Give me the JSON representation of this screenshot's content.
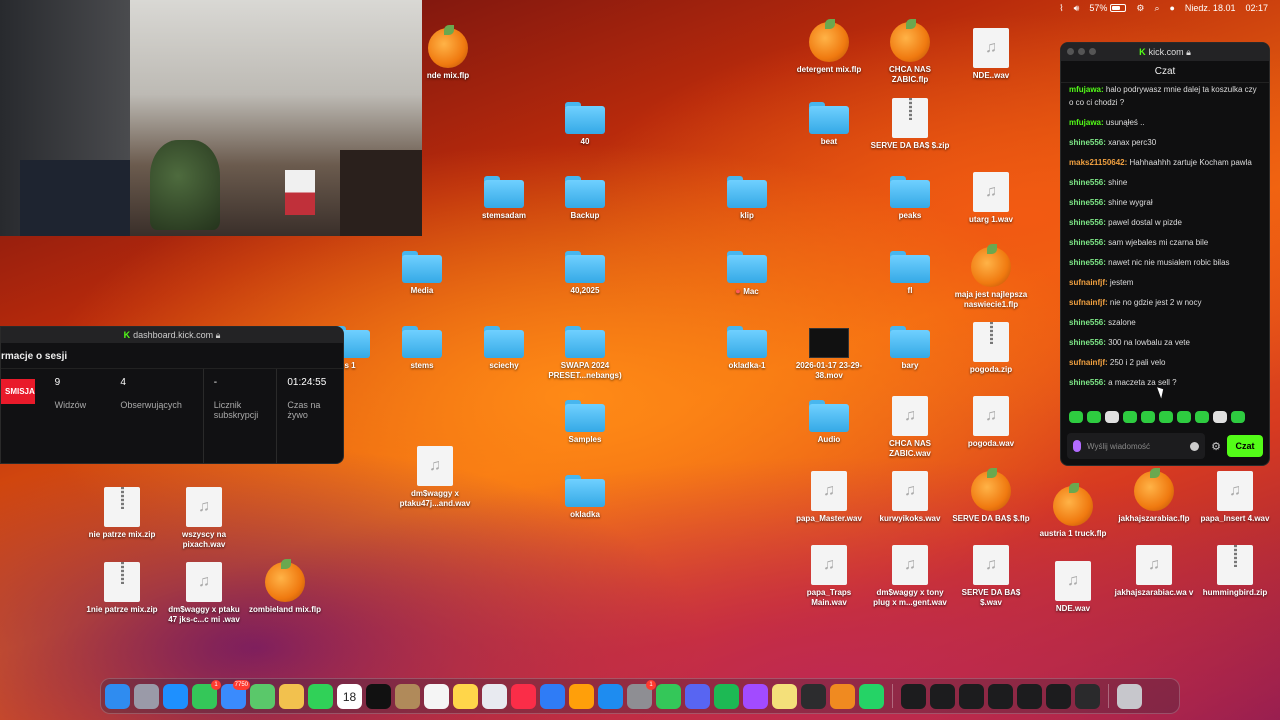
{
  "menubar": {
    "battery": "57%",
    "battery_level": 0.57,
    "date": "Niedz. 18.01",
    "time": "02:17"
  },
  "desktop_icons": [
    {
      "label": "nde mix.flp",
      "type": "flp"
    },
    {
      "label": "40",
      "type": "folder"
    },
    {
      "label": "stemsadam",
      "type": "folder"
    },
    {
      "label": "Backup",
      "type": "folder"
    },
    {
      "label": "Media",
      "type": "folder"
    },
    {
      "label": "40,2025",
      "type": "folder"
    },
    {
      "label": "s 1",
      "type": "folder"
    },
    {
      "label": "stems",
      "type": "folder"
    },
    {
      "label": "sciechy",
      "type": "folder"
    },
    {
      "label": "SWAPA 2024 PRESET...nebangs)",
      "type": "folder"
    },
    {
      "label": "Samples",
      "type": "folder"
    },
    {
      "label": "okladka",
      "type": "folder"
    },
    {
      "label": "dm$waggy x ptaku47j...and.wav",
      "type": "audio"
    },
    {
      "label": "nie patrze mix.zip",
      "type": "zip"
    },
    {
      "label": "wszyscy na pixach.wav",
      "type": "audio"
    },
    {
      "label": "1nie patrze mix.zip",
      "type": "zip"
    },
    {
      "label": "dm$waggy x ptaku 47 jks-c...c mi .wav",
      "type": "audio"
    },
    {
      "label": "zombieland mix.flp",
      "type": "flp"
    },
    {
      "label": "klip",
      "type": "folder"
    },
    {
      "label": "Mac",
      "type": "folder"
    },
    {
      "label": "okladka-1",
      "type": "folder"
    },
    {
      "label": "detergent mix.flp",
      "type": "flp"
    },
    {
      "label": "beat",
      "type": "folder"
    },
    {
      "label": "2026-01-17 23-29-38.mov",
      "type": "video"
    },
    {
      "label": "Audio",
      "type": "folder"
    },
    {
      "label": "papa_Master.wav",
      "type": "audio"
    },
    {
      "label": "papa_Traps Main.wav",
      "type": "audio"
    },
    {
      "label": "CHCA NAS ZABIC.flp",
      "type": "flp"
    },
    {
      "label": "SERVE DA BA$ $.zip",
      "type": "zip"
    },
    {
      "label": "peaks",
      "type": "folder"
    },
    {
      "label": "fl",
      "type": "folder"
    },
    {
      "label": "bary",
      "type": "folder"
    },
    {
      "label": "CHCA NAS ZABIC.wav",
      "type": "audio"
    },
    {
      "label": "kurwyikoks.wav",
      "type": "audio"
    },
    {
      "label": "dm$waggy x tony plug x m...gent.wav",
      "type": "audio"
    },
    {
      "label": "NDE..wav",
      "type": "audio"
    },
    {
      "label": "utarg 1.wav",
      "type": "audio"
    },
    {
      "label": "maja jest najlepsza naswiecie1.flp",
      "type": "flp"
    },
    {
      "label": "pogoda.zip",
      "type": "zip"
    },
    {
      "label": "pogoda.wav",
      "type": "audio"
    },
    {
      "label": "SERVE DA BA$ $.flp",
      "type": "flp"
    },
    {
      "label": "SERVE DA BA$ $.wav",
      "type": "audio"
    },
    {
      "label": "austria 1 truck.flp",
      "type": "flp"
    },
    {
      "label": "NDE.wav",
      "type": "audio"
    },
    {
      "label": "jakhajszarabiac.flp",
      "type": "flp"
    },
    {
      "label": "jakhajszarabiac.wa v",
      "type": "audio"
    },
    {
      "label": "papa_Insert 4.wav",
      "type": "audio"
    },
    {
      "label": "hummingbird.zip",
      "type": "zip"
    }
  ],
  "chat": {
    "window_title": "kick.com",
    "header": "Czat",
    "messages": [
      {
        "user": "mfujawa:",
        "text": "halo podrywasz mnie dalej ta koszulka czy o co ci chodzi ?",
        "color": "#53fc18"
      },
      {
        "user": "mfujawa:",
        "text": "usunąłeś ..",
        "color": "#53fc18"
      },
      {
        "user": "shine556:",
        "text": "xanax perc30",
        "color": "#7ee787"
      },
      {
        "user": "maks21150642:",
        "text": "Hahhaahhh zartuje Kocham pawla",
        "color": "#f0a040"
      },
      {
        "user": "shine556:",
        "text": "shine",
        "color": "#7ee787"
      },
      {
        "user": "shine556:",
        "text": "shine wygrał",
        "color": "#7ee787"
      },
      {
        "user": "shine556:",
        "text": "pawel dostal w pizde",
        "color": "#7ee787"
      },
      {
        "user": "shine556:",
        "text": "sam wjebales mi czarna bile",
        "color": "#7ee787"
      },
      {
        "user": "shine556:",
        "text": "nawet nic nie musialem robic bilas",
        "color": "#7ee787"
      },
      {
        "user": "sufnainfjf:",
        "text": "jestem",
        "color": "#f0a040"
      },
      {
        "user": "sufnainfjf:",
        "text": "nie no gdzie jest 2 w nocy",
        "color": "#f0a040"
      },
      {
        "user": "shine556:",
        "text": "szalone",
        "color": "#7ee787"
      },
      {
        "user": "shine556:",
        "text": "300 na lowbalu za vete",
        "color": "#7ee787"
      },
      {
        "user": "sufnainfjf:",
        "text": "250 i 2 pali velo",
        "color": "#f0a040"
      },
      {
        "user": "shine556:",
        "text": "a maczeta za sell ?",
        "color": "#7ee787"
      }
    ],
    "input_placeholder": "Wyślij wiadomość",
    "send_label": "Czat"
  },
  "dashboard": {
    "window_title": "dashboard.kick.com",
    "section_title": "rmacje o sesji",
    "live_badge": "SMISJA",
    "stats": [
      {
        "value": "9",
        "label": "Widzów"
      },
      {
        "value": "4",
        "label": "Obserwujących"
      },
      {
        "value": "-",
        "label": "Licznik subskrypcji"
      },
      {
        "value": "01:24:55",
        "label": "Czas na żywo"
      }
    ]
  },
  "dock": {
    "apps": [
      {
        "name": "finder-icon",
        "color": "#2f8cf0",
        "badge": ""
      },
      {
        "name": "launchpad-icon",
        "color": "#9a9aa8",
        "badge": ""
      },
      {
        "name": "safari-icon",
        "color": "#1e90ff",
        "badge": ""
      },
      {
        "name": "messages-icon",
        "color": "#34c759",
        "badge": "1"
      },
      {
        "name": "mail-icon",
        "color": "#3a8bfd",
        "badge": "7750"
      },
      {
        "name": "maps-icon",
        "color": "#5ac86a",
        "badge": ""
      },
      {
        "name": "photos-icon",
        "color": "#f2c14e",
        "badge": ""
      },
      {
        "name": "facetime-icon",
        "color": "#30d158",
        "badge": ""
      },
      {
        "name": "calendar-icon",
        "color": "#ffffff",
        "badge": ""
      },
      {
        "name": "tv-icon",
        "color": "#111111",
        "badge": ""
      },
      {
        "name": "contacts-icon",
        "color": "#b08a5a",
        "badge": ""
      },
      {
        "name": "reminders-icon",
        "color": "#f5f5f5",
        "badge": ""
      },
      {
        "name": "notes-icon",
        "color": "#ffd64a",
        "badge": ""
      },
      {
        "name": "freeform-icon",
        "color": "#e8eaf0",
        "badge": ""
      },
      {
        "name": "music-icon",
        "color": "#fa2d48",
        "badge": ""
      },
      {
        "name": "keynote-icon",
        "color": "#2f7cf6",
        "badge": ""
      },
      {
        "name": "pages-icon",
        "color": "#ff9f0a",
        "badge": ""
      },
      {
        "name": "appstore-icon",
        "color": "#1e8cf0",
        "badge": ""
      },
      {
        "name": "settings-icon",
        "color": "#8e8e93",
        "badge": "1"
      },
      {
        "name": "numbers-icon",
        "color": "#34c759",
        "badge": ""
      },
      {
        "name": "discord-icon",
        "color": "#5865f2",
        "badge": ""
      },
      {
        "name": "spotify-icon",
        "color": "#1db954",
        "badge": ""
      },
      {
        "name": "messenger-icon",
        "color": "#a24bff",
        "badge": ""
      },
      {
        "name": "notes-2-icon",
        "color": "#f4e07a",
        "badge": ""
      },
      {
        "name": "activity-icon",
        "color": "#2c2c2e",
        "badge": ""
      },
      {
        "name": "fl-studio-icon",
        "color": "#f08a20",
        "badge": ""
      },
      {
        "name": "whatsapp-icon",
        "color": "#25d366",
        "badge": ""
      },
      {
        "name": "window-thumb-1-icon",
        "color": "#1c1c1e",
        "badge": ""
      },
      {
        "name": "window-thumb-2-icon",
        "color": "#1c1c1e",
        "badge": ""
      },
      {
        "name": "window-thumb-3-icon",
        "color": "#1c1c1e",
        "badge": ""
      },
      {
        "name": "window-thumb-4-icon",
        "color": "#1c1c1e",
        "badge": ""
      },
      {
        "name": "window-thumb-5-icon",
        "color": "#1c1c1e",
        "badge": ""
      },
      {
        "name": "window-thumb-6-icon",
        "color": "#1c1c1e",
        "badge": ""
      },
      {
        "name": "window-thumb-7-icon",
        "color": "#2a2a2c",
        "badge": ""
      },
      {
        "name": "trash-icon",
        "color": "#c7c7cc",
        "badge": ""
      }
    ],
    "calendar_day": "18"
  }
}
